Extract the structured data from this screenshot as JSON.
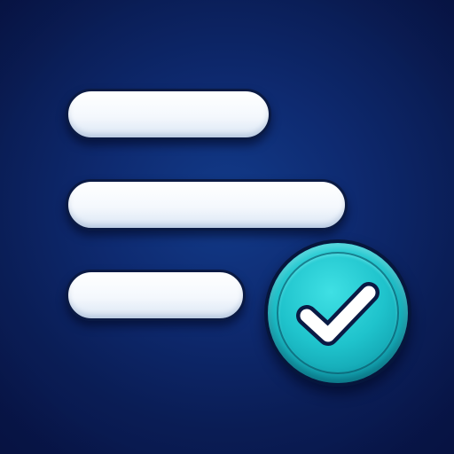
{
  "icon": {
    "lines": [
      "text-line",
      "text-line",
      "text-line"
    ],
    "badge": "checkmark-icon"
  },
  "colors": {
    "background": "#0e2a70",
    "line_fill": "#f4f8fd",
    "badge_fill": "#1fc3cc",
    "outline": "#0a1a44",
    "check": "#ffffff"
  }
}
